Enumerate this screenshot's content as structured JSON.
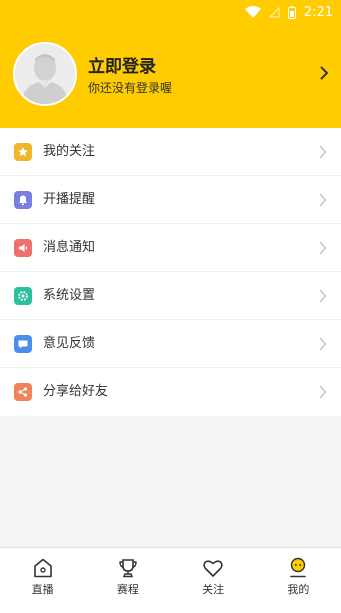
{
  "status_bar": {
    "time": "2:21",
    "accent": "#ffcc00"
  },
  "header": {
    "title": "立即登录",
    "subtitle": "你还没有登录喔",
    "avatar_icon": "user-avatar-icon"
  },
  "menu": {
    "items": [
      {
        "label": "我的关注",
        "icon": "star-icon",
        "color": "#f0b629"
      },
      {
        "label": "开播提醒",
        "icon": "bell-icon",
        "color": "#7b7fe0"
      },
      {
        "label": "消息通知",
        "icon": "speaker-icon",
        "color": "#ef6f6f"
      },
      {
        "label": "系统设置",
        "icon": "settings-icon",
        "color": "#2fbfa0"
      },
      {
        "label": "意见反馈",
        "icon": "chat-bubble-icon",
        "color": "#4a90ea"
      },
      {
        "label": "分享给好友",
        "icon": "share-icon",
        "color": "#f08357"
      }
    ]
  },
  "tabbar": {
    "tabs": [
      {
        "label": "直播",
        "icon": "home-icon",
        "active": false
      },
      {
        "label": "赛程",
        "icon": "trophy-icon",
        "active": false
      },
      {
        "label": "关注",
        "icon": "heart-icon",
        "active": false
      },
      {
        "label": "我的",
        "icon": "profile-face-icon",
        "active": true
      }
    ]
  }
}
